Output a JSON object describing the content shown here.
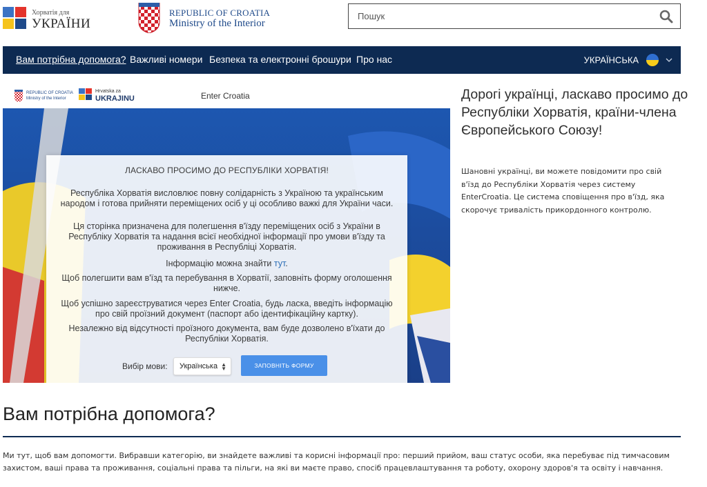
{
  "header": {
    "logo_small": "Хорватія для",
    "logo_big": "УКРАЇНИ",
    "ministry_line1": "REPUBLIC OF CROATIA",
    "ministry_line2": "Ministry of the Interior",
    "search_placeholder": "Пошук",
    "search_icon": "search-icon"
  },
  "nav": {
    "items": [
      {
        "label": "Вам потрібна допомога?",
        "active": true
      },
      {
        "label": "Важливі номери",
        "active": false
      },
      {
        "label": "Безпека та електронні брошури",
        "active": false
      },
      {
        "label": "Про нас",
        "active": false
      }
    ],
    "language": "УКРАЇНСЬКА",
    "language_icon": "ukraine-flag-icon",
    "chevron_icon": "chevron-down-icon"
  },
  "banner": {
    "logo1_line1": "REPUBLIC OF CROATIA",
    "logo1_line2": "Ministry of the Interior",
    "logo2_line1": "Hrvatska za",
    "logo2_line2": "UKRAJINU",
    "enter_title": "Enter Croatia",
    "card": {
      "heading": "ЛАСКАВО ПРОСИМО ДО РЕСПУБЛІКИ ХОРВАТІЯ!",
      "p1": "Республіка Хорватія висловлює повну солідарність з Україною та українським народом і готова прийняти переміщених осіб у ці особливо важкі для України часи.",
      "p2": "Ця сторінка призначена для полегшення в'їзду переміщених осіб з України в Республіку Хорватія та надання всієї необхідної інформації про умови в'їзду та проживання в Республіці Хорватія.",
      "p3_text": "Інформацію можна знайти ",
      "p3_link": "тут",
      "p3_end": ".",
      "p4": "Щоб полегшити вам в'їзд та перебування в Хорватії, заповніть форму оголошення нижче.",
      "p5": "Щоб успішно зареєструватися через Enter Croatia, будь ласка, введіть інформацію про свій проїзний документ (паспорт або ідентифікаційну картку).",
      "p6": "Незалежно від відсутності проїзного документа, вам буде дозволено в'їхати до Республіки Хорватія.",
      "lang_label": "Вибір мови:",
      "lang_selected": "Українська",
      "button": "ЗАПОВНІТЬ ФОРМУ"
    }
  },
  "right": {
    "heading": "Дорогі українці, ласкаво просимо до Республіки Хорватія, країни-члена Європейського Союзу!",
    "text": "Шановні українці, ви можете повідомити про свій в'їзд до Республіки Хорватія через систему EnterCroatia. Це система сповіщення про в'їзд, яка скорочує тривалість прикордонного контролю."
  },
  "help": {
    "title": "Вам потрібна допомога?",
    "intro": "Ми тут, щоб вам допомогти. Вибравши категорію, ви знайдете важливі та корисні інформації про: перший прийом, ваш статус особи, яка перебуває під тимчасовим захистом, ваші права та проживання, соціальні права та пільги, на які ви маєте право, спосіб працевлаштування та роботу, охорону здоров'я та освіту і навчання."
  },
  "colors": {
    "nav_bg": "#0d2a52",
    "button_bg": "#4a90e8",
    "link": "#2d6fb7"
  }
}
